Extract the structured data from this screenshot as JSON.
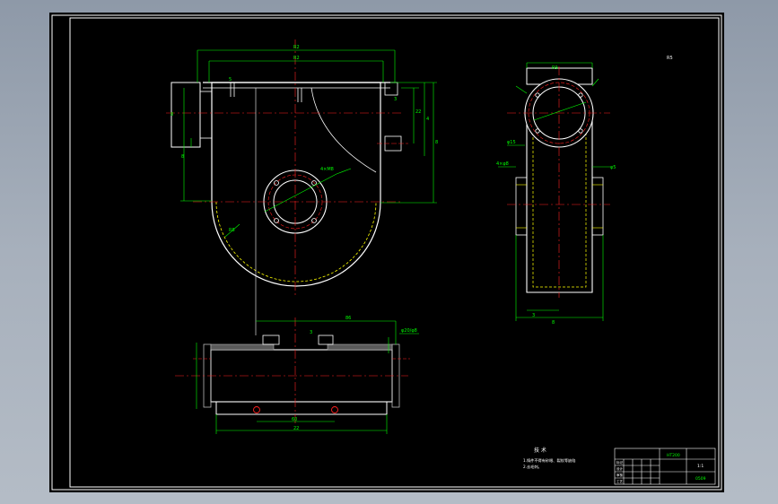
{
  "drawing": {
    "colors": {
      "background": "#000000",
      "outline": "#ffffff",
      "dimension": "#00ff00",
      "centerline": "#ff2020",
      "hidden": "#ffff00",
      "hatch": "#b8b8b8"
    },
    "front_view": {
      "dim_top_outer": "R2",
      "dim_top_inner": "R2",
      "dim_left_height": "8",
      "dim_left_lower": "8",
      "dim_right_a": "22",
      "dim_right_b": "4",
      "dim_right_total": "8",
      "dim_radius": "R8",
      "dim_flange": "4×M8",
      "dim_small_1": "5",
      "dim_small_2": "3"
    },
    "side_view": {
      "dim_top": "R9",
      "dim_bottom_inner": "3",
      "dim_bottom_total": "8",
      "dim_left_tag": "φ15",
      "dim_right_tag": "φ5",
      "dim_left_tag2": "4×φ8",
      "corner_note": "R5"
    },
    "bottom_view": {
      "dim_top": "86",
      "dim_bottom_inner": "60",
      "dim_bottom_total": "22",
      "dim_right_tag": "φ20/φ8",
      "dim_small": "3"
    }
  },
  "notes": {
    "heading": "技 术",
    "line1": "1.铸件不得有砂眼、裂纹等缺陷",
    "line2": "2.去毛刺。"
  },
  "title_block": {
    "material": "HT200",
    "drawing_no": "0509",
    "scale": "1:1",
    "row_labels": [
      "标记",
      "设计",
      "审核",
      "工艺"
    ]
  }
}
